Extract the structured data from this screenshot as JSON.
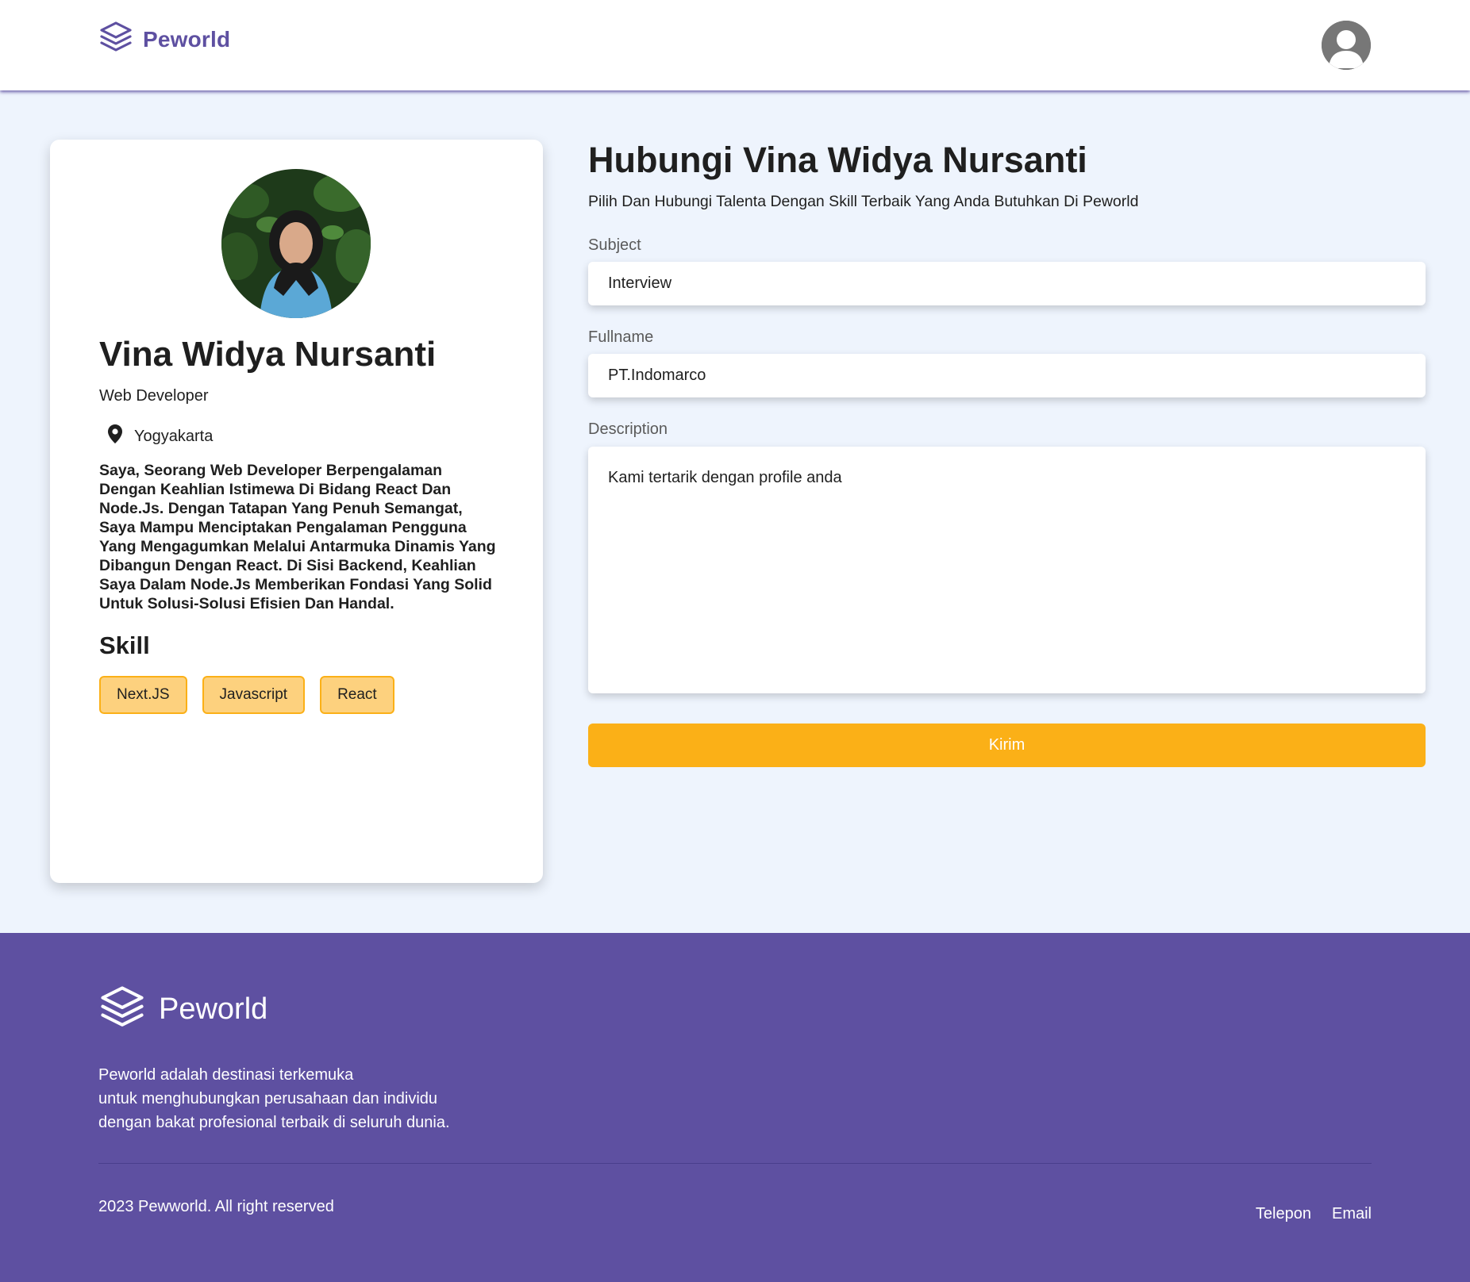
{
  "header": {
    "brand_name": "Peworld"
  },
  "profile": {
    "name": "Vina Widya Nursanti",
    "job": "Web Developer",
    "location": "Yogyakarta",
    "bio": "Saya, Seorang Web Developer Berpengalaman Dengan Keahlian Istimewa Di Bidang React Dan Node.Js. Dengan Tatapan Yang Penuh Semangat, Saya Mampu Menciptakan Pengalaman Pengguna Yang Mengagumkan Melalui Antarmuka Dinamis Yang Dibangun Dengan React. Di Sisi Backend, Keahlian Saya Dalam Node.Js Memberikan Fondasi Yang Solid Untuk Solusi-Solusi Efisien Dan Handal.",
    "skill_title": "Skill",
    "skills": [
      "Next.JS",
      "Javascript",
      "React"
    ]
  },
  "contact": {
    "title": "Hubungi Vina Widya Nursanti",
    "subtitle": "Pilih Dan Hubungi Talenta Dengan Skill Terbaik Yang Anda Butuhkan Di Peworld",
    "subject_label": "Subject",
    "subject_value": "Interview",
    "fullname_label": "Fullname",
    "fullname_value": "PT.Indomarco",
    "description_label": "Description",
    "description_value": "Kami tertarik dengan profile anda",
    "submit_label": "Kirim"
  },
  "footer": {
    "brand_name": "Peworld",
    "description_lines": [
      "Peworld adalah destinasi terkemuka",
      "untuk menghubungkan perusahaan dan individu",
      "dengan bakat profesional terbaik di seluruh dunia."
    ],
    "copyright": "2023 Pewworld. All right reserved",
    "links": [
      "Telepon",
      "Email"
    ]
  },
  "colors": {
    "brand": "#5E50A1",
    "accent": "#FBB017",
    "skill_bg": "#FDD17E",
    "page_bg": "#EEF4FD"
  },
  "icons": {
    "logo": "stacked-layers-icon",
    "avatar": "user-avatar-icon",
    "location": "map-pin-icon"
  }
}
